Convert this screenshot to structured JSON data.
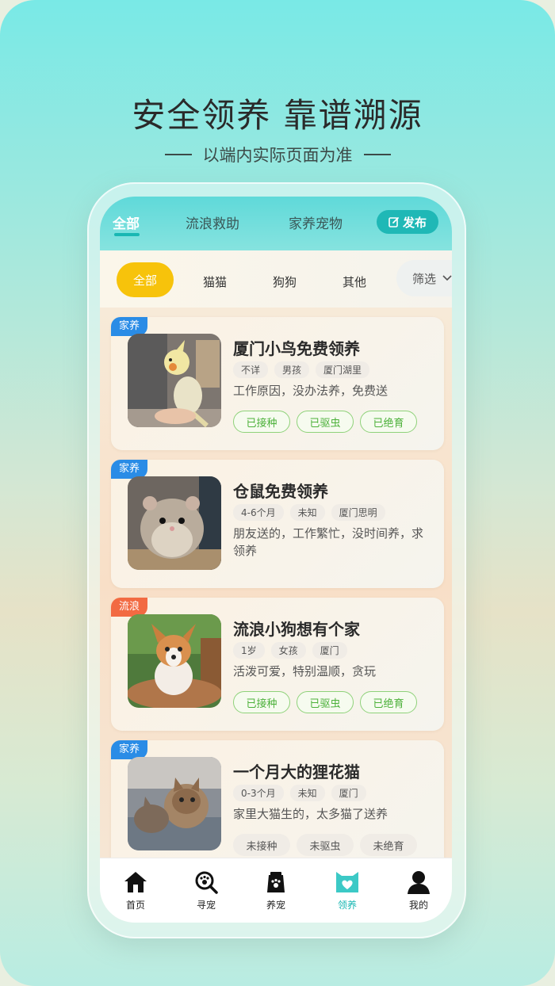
{
  "headline": "安全领养 靠谱溯源",
  "subline": "以端内实际页面为准",
  "tabs": [
    {
      "label": "全部",
      "active": true
    },
    {
      "label": "流浪救助",
      "active": false
    },
    {
      "label": "家养宠物",
      "active": false
    }
  ],
  "publish_label": "发布",
  "categories": [
    {
      "label": "全部",
      "active": true
    },
    {
      "label": "猫猫",
      "active": false
    },
    {
      "label": "狗狗",
      "active": false
    },
    {
      "label": "其他",
      "active": false
    }
  ],
  "filter_label": "筛选",
  "cards": [
    {
      "badge": "家养",
      "title": "厦门小鸟免费领养",
      "tags": [
        "不详",
        "男孩",
        "厦门湖里"
      ],
      "desc": "工作原因，没办法养，免费送",
      "status": [
        "已接种",
        "已驱虫",
        "已绝育"
      ]
    },
    {
      "badge": "家养",
      "title": "仓鼠免费领养",
      "tags": [
        "4-6个月",
        "未知",
        "厦门思明"
      ],
      "desc": "朋友送的，工作繁忙，没时间养，求领养",
      "status": []
    },
    {
      "badge": "流浪",
      "title": "流浪小狗想有个家",
      "tags": [
        "1岁",
        "女孩",
        "厦门"
      ],
      "desc": "活泼可爱，特别温顺，贪玩",
      "status": [
        "已接种",
        "已驱虫",
        "已绝育"
      ]
    },
    {
      "badge": "家养",
      "title": "一个月大的狸花猫",
      "tags": [
        "0-3个月",
        "未知",
        "厦门"
      ],
      "desc": "家里大猫生的，太多猫了送养",
      "status": [
        "未接种",
        "未驱虫",
        "未绝育"
      ]
    }
  ],
  "nav": [
    {
      "label": "首页",
      "icon": "home-icon"
    },
    {
      "label": "寻宠",
      "icon": "search-paw-icon"
    },
    {
      "label": "养宠",
      "icon": "pet-food-bag-icon"
    },
    {
      "label": "领养",
      "icon": "adopt-cat-heart-icon",
      "active": true
    },
    {
      "label": "我的",
      "icon": "user-icon"
    }
  ],
  "colors": {
    "accent": "#1fb8b6",
    "chip_active": "#f7c30b",
    "badge_home": "#2a8ce6",
    "badge_stray": "#f26a42",
    "status_green": "#4cb13a"
  }
}
